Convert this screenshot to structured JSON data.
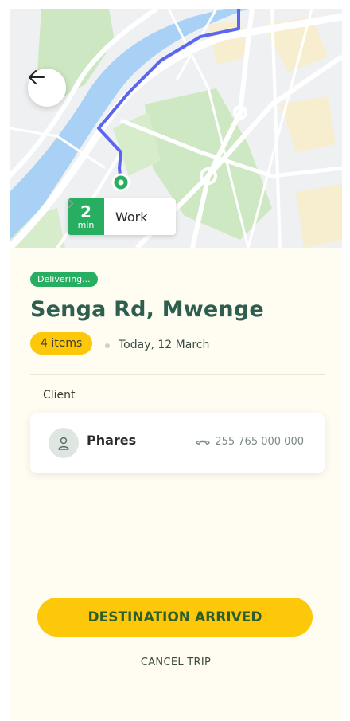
{
  "map": {
    "eta_value": "2",
    "eta_unit": "min",
    "destination_label": "Work"
  },
  "delivery": {
    "status": "Delivering...",
    "address": "Senga Rd, Mwenge",
    "items": "4 items",
    "date": "Today, 12 March"
  },
  "client": {
    "section_label": "Client",
    "name": "Phares",
    "phone": "255 765 000 000"
  },
  "actions": {
    "arrived": "DESTINATION ARRIVED",
    "cancel": "CANCEL TRIP"
  },
  "colors": {
    "accent_green": "#27ae60",
    "accent_yellow": "#fec80a",
    "title_green": "#2e5e4e",
    "route_blue": "#5b66f0"
  }
}
